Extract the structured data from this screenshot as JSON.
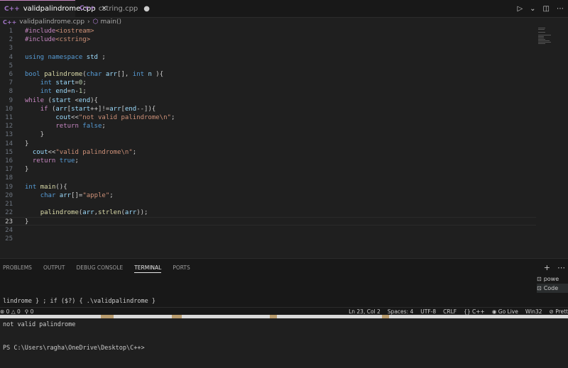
{
  "tabs": [
    {
      "icon": "C++",
      "label": "validpalindrome.cpp",
      "indicator": "✕",
      "active": true
    },
    {
      "icon": "C++",
      "label": "cstring.cpp",
      "indicator": "●",
      "active": false
    }
  ],
  "breadcrumb": {
    "file": "validpalindrome.cpp",
    "symbol": "main()"
  },
  "code": [
    {
      "n": "1",
      "t": "#include<iostream>"
    },
    {
      "n": "2",
      "t": "#include<cstring>"
    },
    {
      "n": "3",
      "t": ""
    },
    {
      "n": "4",
      "t": "using namespace std ;"
    },
    {
      "n": "5",
      "t": ""
    },
    {
      "n": "6",
      "t": "bool palindrome(char arr[], int n ){"
    },
    {
      "n": "7",
      "t": "    int start=0;"
    },
    {
      "n": "8",
      "t": "    int end=n-1;"
    },
    {
      "n": "9",
      "t": "while (start <end){"
    },
    {
      "n": "10",
      "t": "    if (arr[start++]!=arr[end--]){"
    },
    {
      "n": "11",
      "t": "        cout<<\"not valid palindrome\\n\";"
    },
    {
      "n": "12",
      "t": "        return false;"
    },
    {
      "n": "13",
      "t": "    }"
    },
    {
      "n": "14",
      "t": "}"
    },
    {
      "n": "15",
      "t": "  cout<<\"valid palindrome\\n\";"
    },
    {
      "n": "16",
      "t": "  return true;"
    },
    {
      "n": "17",
      "t": "}"
    },
    {
      "n": "18",
      "t": ""
    },
    {
      "n": "19",
      "t": "int main(){"
    },
    {
      "n": "20",
      "t": "    char arr[]=\"apple\";"
    },
    {
      "n": "21",
      "t": ""
    },
    {
      "n": "22",
      "t": "    palindrome(arr,strlen(arr));"
    },
    {
      "n": "23",
      "t": "}"
    },
    {
      "n": "24",
      "t": ""
    },
    {
      "n": "25",
      "t": ""
    }
  ],
  "panel": {
    "tabs": [
      "PROBLEMS",
      "OUTPUT",
      "DEBUG CONSOLE",
      "TERMINAL",
      "PORTS"
    ],
    "active_tab": "TERMINAL",
    "terminal_lines": [
      "lindrome } ; if ($?) { .\\validpalindrome }",
      "not valid palindrome",
      "PS C:\\Users\\ragha\\OneDrive\\Desktop\\C++>"
    ],
    "terminal_list": [
      "powe",
      "Code"
    ]
  },
  "status": {
    "errors": "0",
    "warnings": "0",
    "ports": "0",
    "position": "Ln 23, Col 2",
    "spaces": "Spaces: 4",
    "encoding": "UTF-8",
    "eol": "CRLF",
    "language": "C++",
    "golive": "Go Live",
    "platform": "Win32",
    "prettier": "Prett"
  },
  "colors": {
    "accent": "#c586c0",
    "keyword": "#569cd6",
    "string": "#ce9178",
    "function": "#dcdcaa"
  }
}
